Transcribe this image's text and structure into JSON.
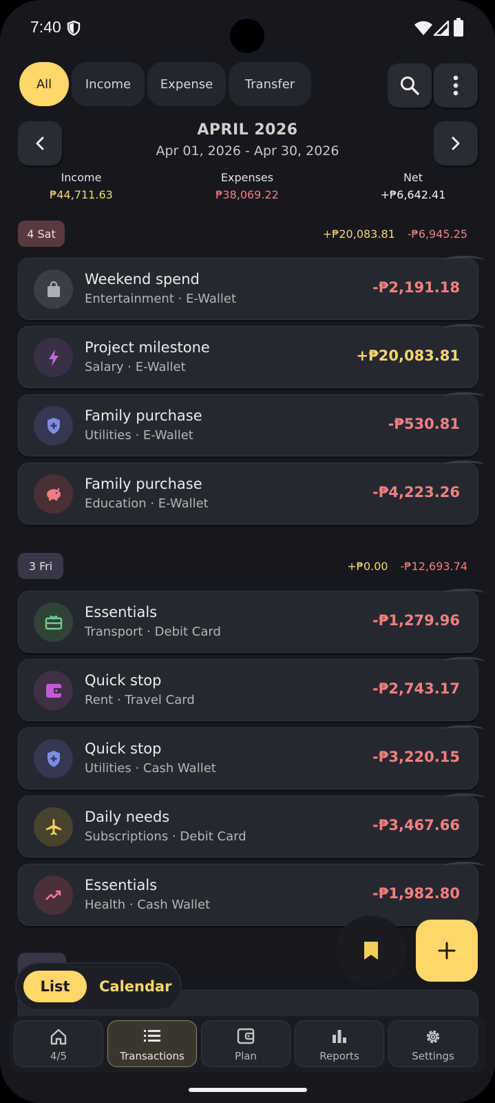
{
  "status_bar": {
    "time": "7:40"
  },
  "filters": {
    "all": "All",
    "income": "Income",
    "expense": "Expense",
    "transfer": "Transfer"
  },
  "header": {
    "month": "APRIL 2026",
    "range": "Apr 01, 2026 - Apr 30, 2026"
  },
  "summary": {
    "income_label": "Income",
    "income_value": "₱44,711.63",
    "expenses_label": "Expenses",
    "expenses_value": "₱38,069.22",
    "net_label": "Net",
    "net_value": "+₱6,642.41"
  },
  "days": [
    {
      "label": "4 Sat",
      "income": "+₱20,083.81",
      "expense": "-₱6,945.25",
      "items": [
        {
          "title": "Weekend spend",
          "sub": "Entertainment · E-Wallet",
          "amount": "-₱2,191.18",
          "icon": "shopping-bag-icon"
        },
        {
          "title": "Project milestone",
          "sub": "Salary · E-Wallet",
          "amount": "+₱20,083.81",
          "icon": "bolt-icon"
        },
        {
          "title": "Family purchase",
          "sub": "Utilities · E-Wallet",
          "amount": "-₱530.81",
          "icon": "shield-plus-icon"
        },
        {
          "title": "Family purchase",
          "sub": "Education · E-Wallet",
          "amount": "-₱4,223.26",
          "icon": "piggy-bank-icon"
        }
      ]
    },
    {
      "label": "3 Fri",
      "income": "+₱0.00",
      "expense": "-₱12,693.74",
      "items": [
        {
          "title": "Essentials",
          "sub": "Transport · Debit Card",
          "amount": "-₱1,279.96",
          "icon": "gift-card-icon"
        },
        {
          "title": "Quick stop",
          "sub": "Rent · Travel Card",
          "amount": "-₱2,743.17",
          "icon": "wallet-icon"
        },
        {
          "title": "Quick stop",
          "sub": "Utilities · Cash Wallet",
          "amount": "-₱3,220.15",
          "icon": "shield-plus-icon"
        },
        {
          "title": "Daily needs",
          "sub": "Subscriptions · Debit Card",
          "amount": "-₱3,467.66",
          "icon": "airplane-icon"
        },
        {
          "title": "Essentials",
          "sub": "Health · Cash Wallet",
          "amount": "-₱1,982.80",
          "icon": "trending-up-icon"
        }
      ]
    }
  ],
  "view_toggle": {
    "list": "List",
    "calendar": "Calendar"
  },
  "nav": {
    "home": "4/5",
    "transactions": "Transactions",
    "plan": "Plan",
    "reports": "Reports",
    "settings": "Settings"
  },
  "colors": {
    "accent": "#ffd76a",
    "negative": "#f08080",
    "positive": "#f7d56b",
    "background": "#17181e",
    "card": "#262830"
  }
}
